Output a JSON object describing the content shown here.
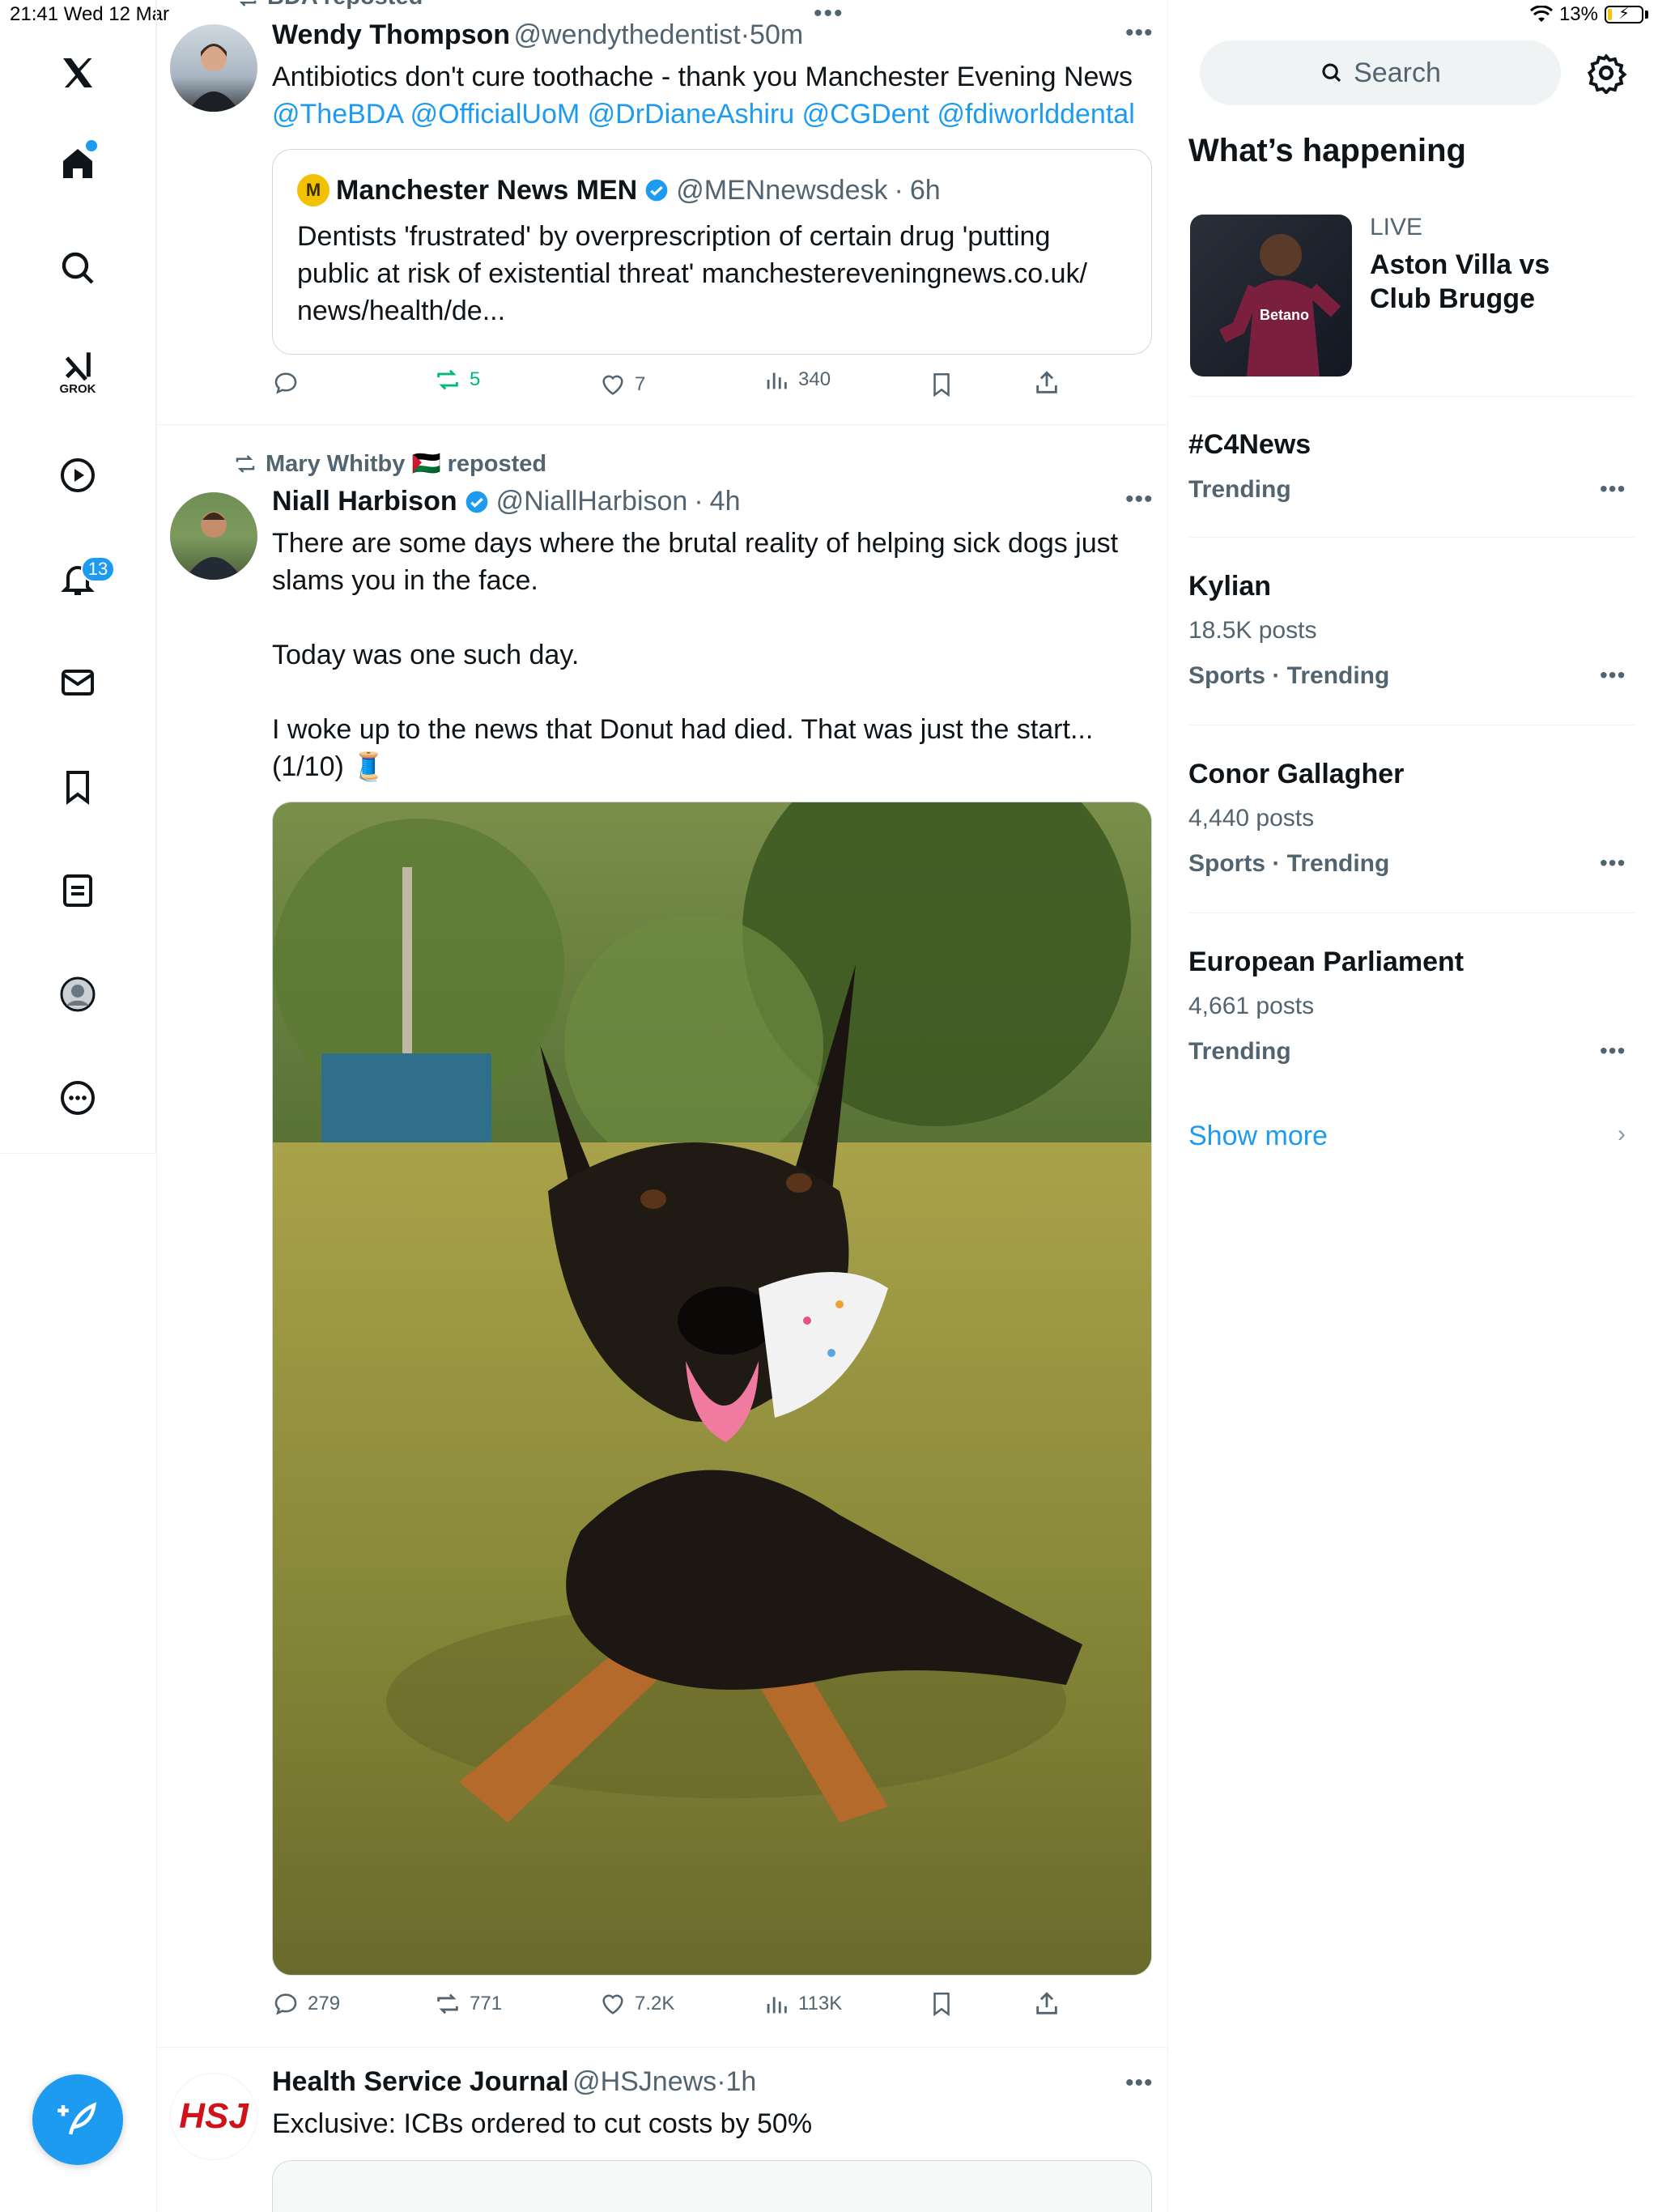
{
  "status_bar": {
    "time_date": "21:41  Wed 12 Mar",
    "battery": "13%",
    "battery_level": 0.13
  },
  "nav": {
    "items": [
      "x-logo",
      "home",
      "explore",
      "grok",
      "video",
      "notifications",
      "messages",
      "bookmarks",
      "lists",
      "profile",
      "more"
    ],
    "grok_label": "GROK",
    "notifications_badge": "13"
  },
  "tweets": [
    {
      "repost_label": "BDA reposted",
      "name": "Wendy Thompson",
      "handle": "@wendythedentist",
      "time": "50m",
      "text": "Antibiotics don't cure toothache - thank you Manchester Evening News",
      "mentions": "@TheBDA @OfficialUoM @DrDianeAshiru @CGDent @fdiworlddental",
      "quote": {
        "name": "Manchester News MEN",
        "handle": "@MENnewsdesk",
        "time": "6h",
        "text": "Dentists 'frustrated' by overprescription of certain drug 'putting public at risk of existential threat' manchestereveningnews.co.uk/ news/health/de..."
      },
      "stats": {
        "replies": "",
        "reposts": "5",
        "likes": "7",
        "views": "340"
      }
    },
    {
      "repost_label": "Mary Whitby 🇵🇸 reposted",
      "name": "Niall Harbison",
      "handle": "@NiallHarbison",
      "time": "4h",
      "text_lines": [
        "There are some days where the brutal reality of helping sick dogs just slams you in the face.",
        "Today was one such day.",
        "I woke up to the news that Donut had died. That was just the start... (1/10) 🧵"
      ],
      "stats": {
        "replies": "279",
        "reposts": "771",
        "likes": "7.2K",
        "views": "113K"
      }
    },
    {
      "name": "Health Service Journal",
      "handle": "@HSJnews",
      "time": "1h",
      "text": "Exclusive: ICBs ordered to cut costs by 50%",
      "avatar_text": "HSJ"
    }
  ],
  "sidebar": {
    "search_placeholder": "Search",
    "heading": "What’s happening",
    "live": {
      "label": "LIVE",
      "title": "Aston Villa vs Club Brugge",
      "shirt_text": "Betano"
    },
    "trends": [
      {
        "title": "#C4News",
        "posts": "",
        "meta": "Trending"
      },
      {
        "title": "Kylian",
        "posts": "18.5K posts",
        "meta": "Sports · Trending"
      },
      {
        "title": "Conor Gallagher",
        "posts": "4,440 posts",
        "meta": "Sports · Trending"
      },
      {
        "title": "European Parliament",
        "posts": "4,661 posts",
        "meta": "Trending"
      }
    ],
    "show_more": "Show more"
  }
}
